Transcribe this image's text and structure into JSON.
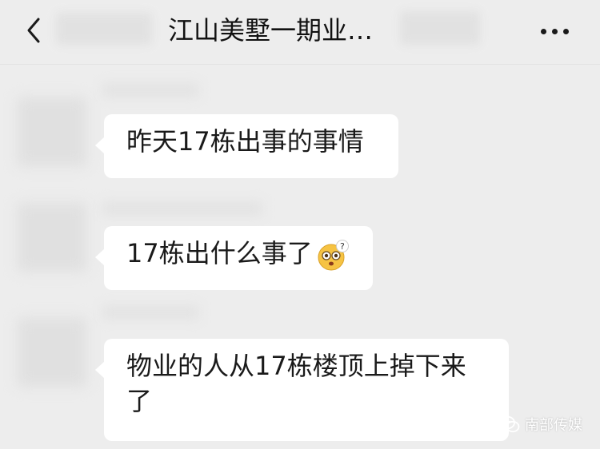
{
  "header": {
    "title": "江山美墅一期业…",
    "more_icon": "more-dots-icon",
    "back_icon": "chevron-left-icon"
  },
  "messages": [
    {
      "text": "昨天17栋出事的事情"
    },
    {
      "text": "17栋出什么事了",
      "emoji": "dizzy-question-emoji"
    },
    {
      "text": "物业的人从17栋楼顶上掉下来了"
    }
  ],
  "watermark": {
    "text": "南部传媒",
    "icon": "wechat-icon"
  },
  "colors": {
    "background": "#ededed",
    "bubble": "#ffffff",
    "text": "#1a1a1a"
  }
}
